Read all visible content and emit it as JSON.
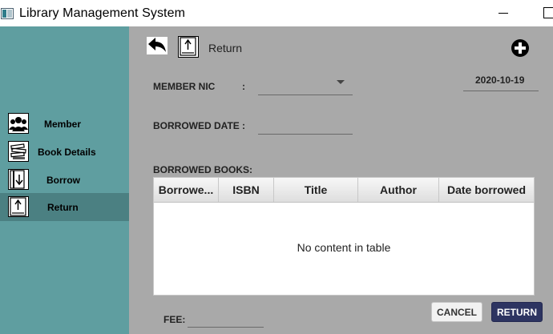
{
  "window": {
    "title": "Library Management System"
  },
  "sidebar": {
    "items": [
      {
        "label": "Member",
        "icon": "members-icon",
        "active": false
      },
      {
        "label": "Book Details",
        "icon": "books-icon",
        "active": false
      },
      {
        "label": "Borrow",
        "icon": "borrow-icon",
        "active": false
      },
      {
        "label": "Return",
        "icon": "return-icon",
        "active": true
      }
    ]
  },
  "header": {
    "title": "Return",
    "back_icon": "back-arrow-icon",
    "add_icon": "plus-circle-icon"
  },
  "form": {
    "member_nic_label": "MEMBER NIC",
    "colon": ":",
    "member_nic_value": "",
    "date": "2020-10-19",
    "borrowed_date_label": "BORROWED DATE",
    "borrowed_date_value": "",
    "borrowed_books_label": "BORROWED BOOKS:",
    "fee_label": "FEE:",
    "fee_value": ""
  },
  "table": {
    "columns": [
      "Borrowe...",
      "ISBN",
      "Title",
      "Author",
      "Date borrowed"
    ],
    "rows": [],
    "empty_message": "No content in table"
  },
  "buttons": {
    "cancel": "CANCEL",
    "return": "RETURN"
  },
  "colors": {
    "sidebar": "#5f9ea0",
    "sidebar_active": "#4b8082",
    "main": "#a9a9a9",
    "return_button": "#2d3461"
  }
}
